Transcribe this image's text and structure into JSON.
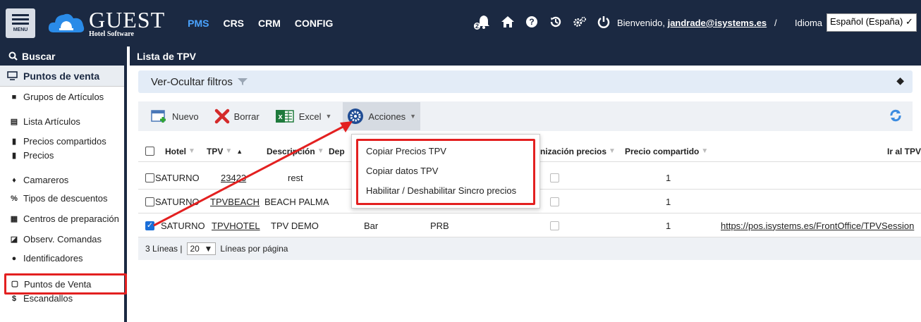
{
  "header": {
    "menu_label": "MENU",
    "logo_big": "GUEST",
    "logo_small": "Hotel Software",
    "nav": [
      {
        "label": "PMS",
        "active": true
      },
      {
        "label": "CRS",
        "active": false
      },
      {
        "label": "CRM",
        "active": false
      },
      {
        "label": "CONFIG",
        "active": false
      }
    ],
    "notifications_count": "2",
    "welcome_text": "Bienvenido,",
    "user": "jandrade@isystems.es",
    "separator": "/",
    "language_label": "Idioma",
    "language_value": "Español (España) ✓"
  },
  "sidebar": {
    "search_label": "Buscar",
    "section_label": "Puntos de venta",
    "items": [
      {
        "label": "Grupos de Artículos",
        "icon": "folder-icon"
      },
      {
        "label": "Lista Artículos",
        "icon": "list-icon"
      },
      {
        "label": "Precios compartidos",
        "icon": "file-icon"
      },
      {
        "label": "Precios",
        "icon": "price-file-icon"
      },
      {
        "label": "Camareros",
        "icon": "person-icon"
      },
      {
        "label": "Tipos de descuentos",
        "icon": "percent-icon"
      },
      {
        "label": "Centros de preparación",
        "icon": "building-icon"
      },
      {
        "label": "Observ. Comandas",
        "icon": "edit-icon"
      },
      {
        "label": "Identificadores",
        "icon": "user-circle-icon"
      },
      {
        "label": "Puntos de Venta",
        "icon": "tablet-icon"
      },
      {
        "label": "Escandallos",
        "icon": "dollar-icon"
      }
    ]
  },
  "main": {
    "title": "Lista de TPV",
    "filter_toggle": "Ver-Ocultar filtros",
    "toolbar": {
      "new": "Nuevo",
      "delete": "Borrar",
      "excel": "Excel",
      "actions": "Acciones"
    },
    "columns": [
      "Hotel",
      "TPV",
      "Descripción",
      "Dep",
      "nización precios",
      "Precio compartido",
      "Ir al TPV"
    ],
    "rows": [
      {
        "checked": false,
        "hotel": "SATURNO",
        "tpv": "23423",
        "descripcion": "rest",
        "dep": "",
        "code": "",
        "precio_compartido": "1",
        "url": ""
      },
      {
        "checked": false,
        "hotel": "SATURNO",
        "tpv": "TPVBEACH",
        "descripcion": "BEACH PALMA",
        "dep": "",
        "code": "",
        "precio_compartido": "1",
        "url": ""
      },
      {
        "checked": true,
        "hotel": "SATURNO",
        "tpv": "TPVHOTEL",
        "descripcion": "TPV DEMO",
        "dep": "Bar",
        "code": "PRB",
        "precio_compartido": "1",
        "url": "https://pos.isystems.es/FrontOffice/TPVSession"
      }
    ],
    "pager": {
      "lines_text": "3 Líneas |",
      "page_size": "20",
      "per_page_text": "Líneas por página"
    },
    "actions_menu": [
      "Copiar Precios TPV",
      "Copiar datos TPV",
      "Habilitar / Deshabilitar Sincro precios"
    ]
  },
  "colors": {
    "header_bg": "#1b2942",
    "highlight": "#e32020",
    "active_nav": "#4aa3ff"
  }
}
